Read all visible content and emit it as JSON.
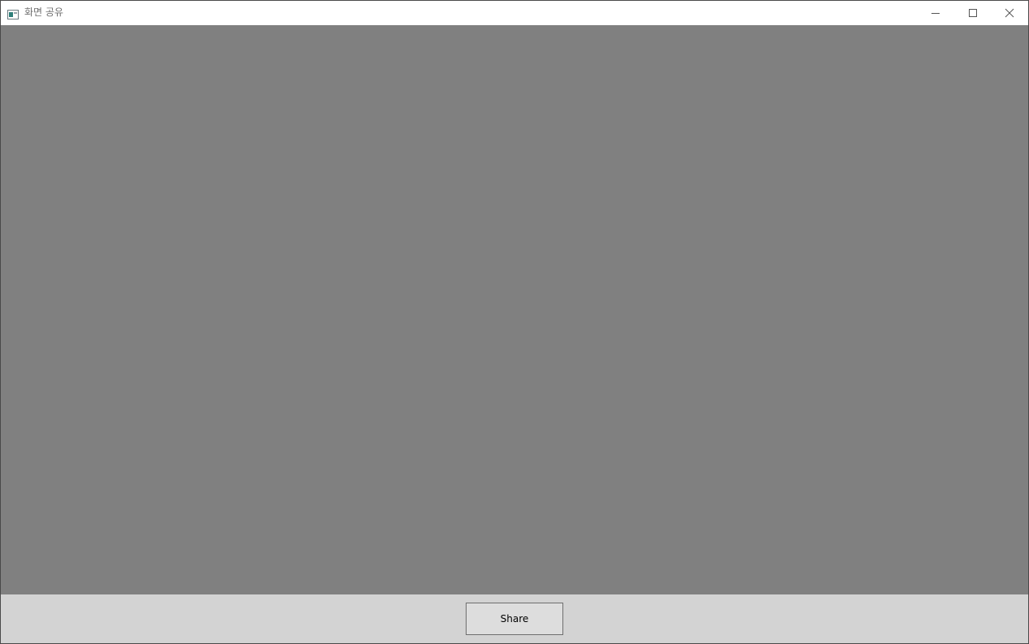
{
  "window": {
    "title": "화면 공유",
    "controls": {
      "minimize": "minimize-icon",
      "maximize": "maximize-icon",
      "close": "close-icon"
    }
  },
  "preview": {
    "background": "#808080"
  },
  "footer": {
    "share_label": "Share",
    "background": "#d3d3d3"
  }
}
